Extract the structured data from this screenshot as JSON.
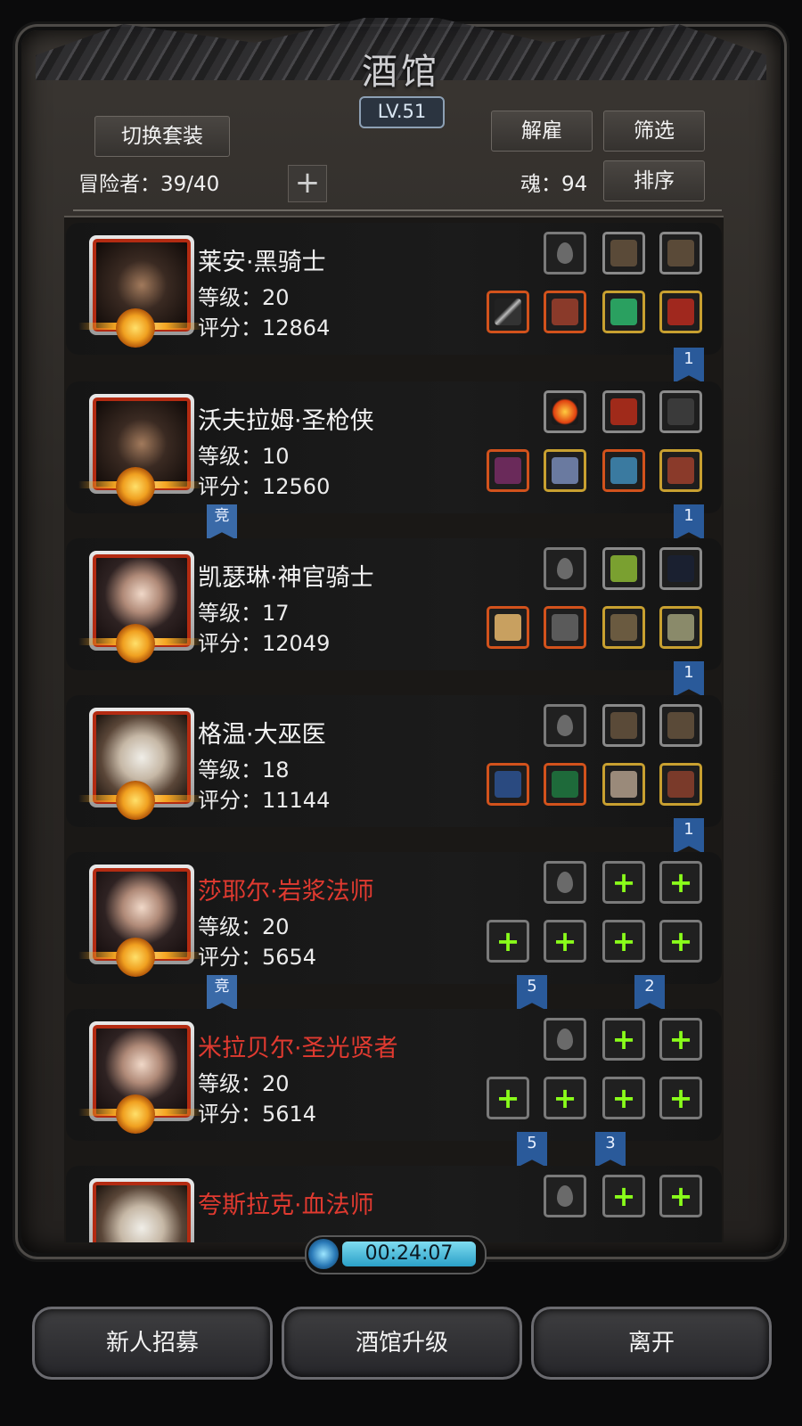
{
  "header": {
    "title": "酒馆",
    "level": "LV.51",
    "switch_outfit": "切换套装",
    "dismiss": "解雇",
    "filter": "筛选",
    "sort": "排序",
    "adventurers_label": "冒险者：39/40",
    "soul_label": "魂：94",
    "add_symbol": "+"
  },
  "heroes": [
    {
      "name": "莱安·黑骑士",
      "level": "等级：20",
      "score": "评分：12864",
      "name_color": "white"
    },
    {
      "name": "沃夫拉姆·圣枪侠",
      "level": "等级：10",
      "score": "评分：12560",
      "name_color": "white"
    },
    {
      "name": "凯瑟琳·神官骑士",
      "level": "等级：17",
      "score": "评分：12049",
      "name_color": "white"
    },
    {
      "name": "格温·大巫医",
      "level": "等级：18",
      "score": "评分：11144",
      "name_color": "white"
    },
    {
      "name": "莎耶尔·岩浆法师",
      "level": "等级：20",
      "score": "评分：5654",
      "name_color": "red"
    },
    {
      "name": "米拉贝尔·圣光贤者",
      "level": "等级：20",
      "score": "评分：5614",
      "name_color": "red"
    },
    {
      "name": "夸斯拉克·血法师",
      "level": "",
      "score": "",
      "name_color": "red"
    }
  ],
  "ribbons": {
    "r1": "1",
    "r2": "1",
    "r2_vs": "竞",
    "r3": "1",
    "r4": "1",
    "r5_vs": "竞",
    "r5_a": "5",
    "r5_b": "2",
    "r6_a": "5",
    "r6_b": "3"
  },
  "timer": "00:24:07",
  "bottom": {
    "recruit": "新人招募",
    "upgrade": "酒馆升级",
    "leave": "离开"
  },
  "colors": {
    "accent_red": "#e03a30",
    "slot_plus_green": "#8aff1a",
    "ribbon_blue": "#2a5a9a"
  }
}
